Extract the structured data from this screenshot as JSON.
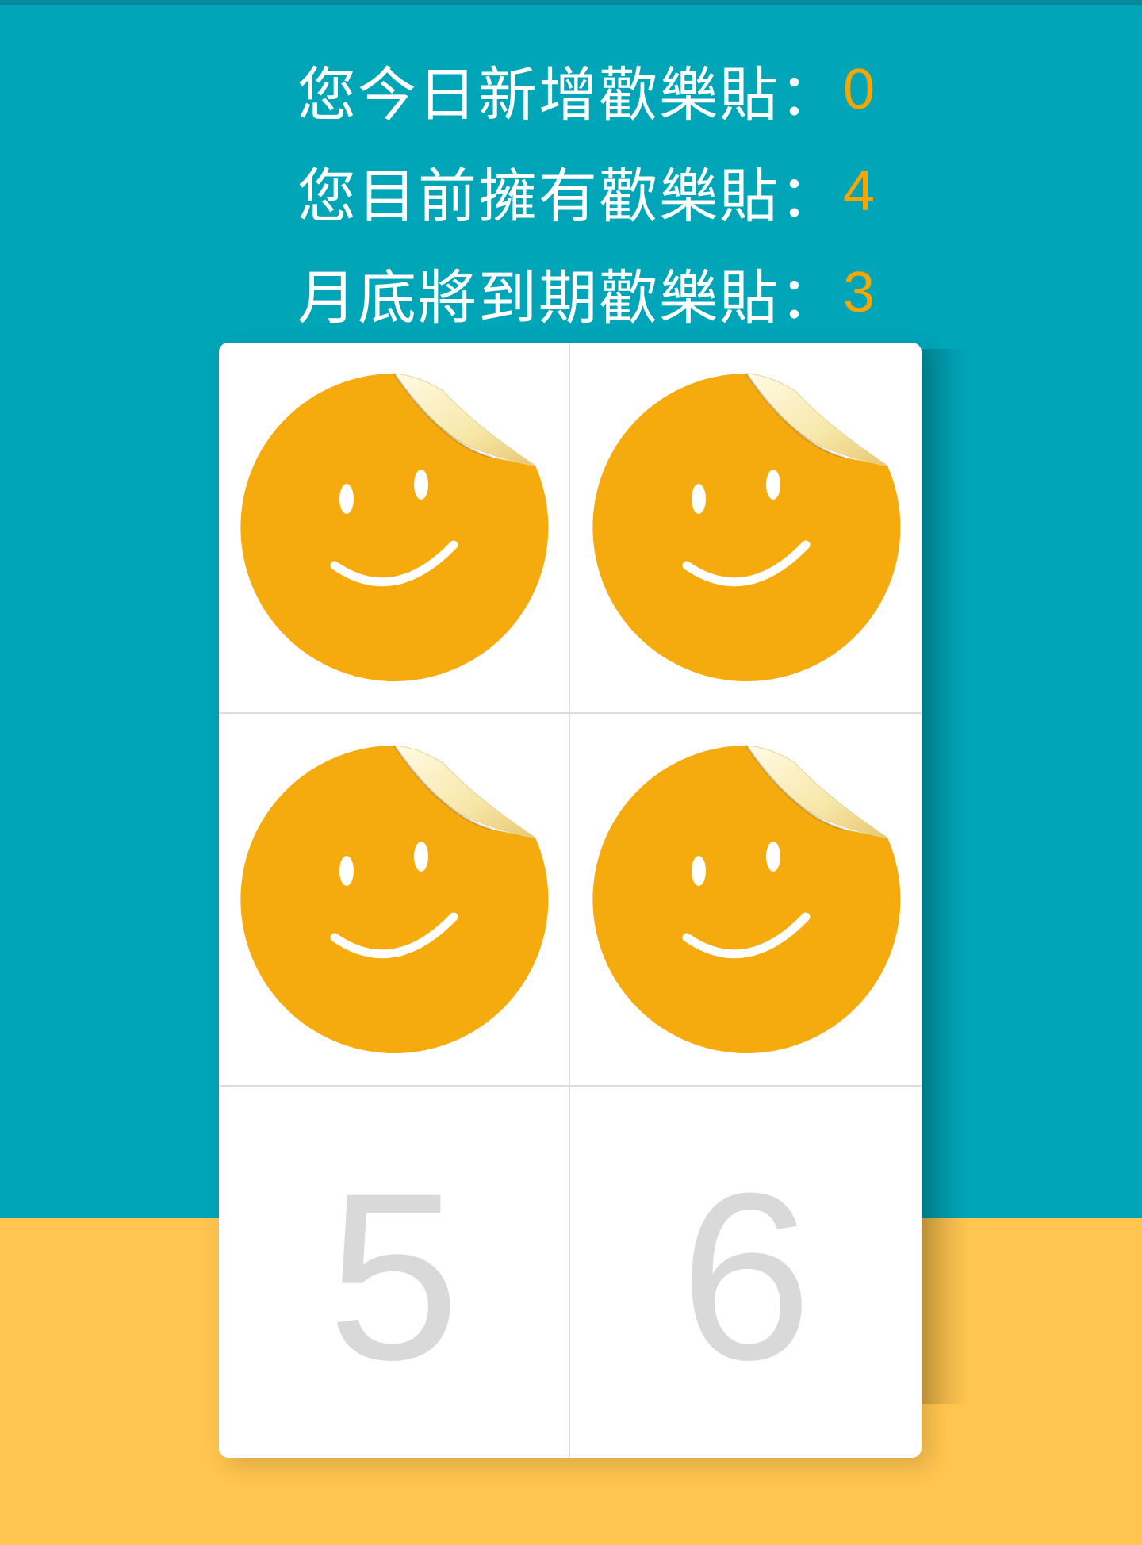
{
  "stats": {
    "today_added": {
      "label": "您今日新增歡樂貼：",
      "value": "0"
    },
    "current_owned": {
      "label": "您目前擁有歡樂貼：",
      "value": "4"
    },
    "expiring_month_end": {
      "label": "月底將到期歡樂貼：",
      "value": "3"
    }
  },
  "card": {
    "slots": [
      {
        "filled": true,
        "icon": "smiley-sticker-icon"
      },
      {
        "filled": true,
        "icon": "smiley-sticker-icon"
      },
      {
        "filled": true,
        "icon": "smiley-sticker-icon"
      },
      {
        "filled": true,
        "icon": "smiley-sticker-icon"
      },
      {
        "filled": false,
        "number": "5"
      },
      {
        "filled": false,
        "number": "6"
      }
    ]
  },
  "colors": {
    "background_top": "#00a5b8",
    "background_bottom": "#ffc54f",
    "accent_number": "#f7a600",
    "sticker": "#f5aa0d",
    "empty_number": "#d9d9d9"
  }
}
